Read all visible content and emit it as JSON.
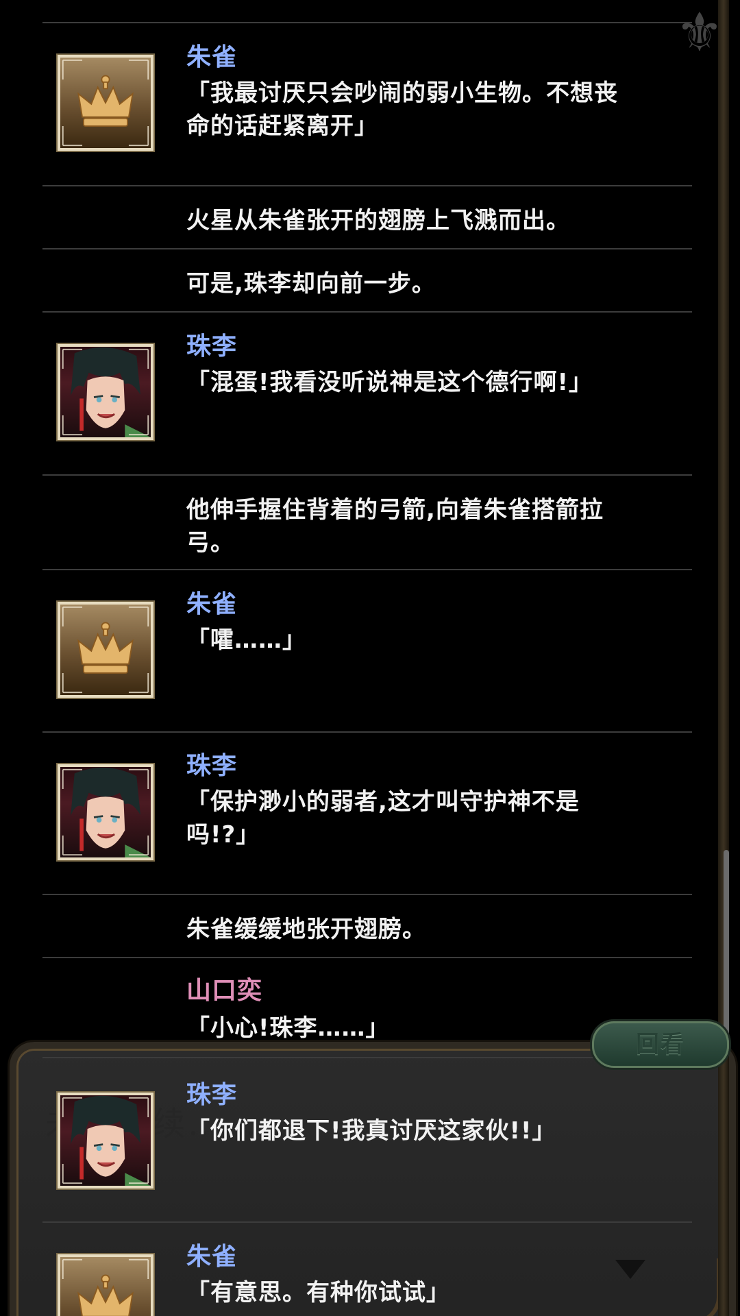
{
  "log": {
    "entries": [
      {
        "speaker": "朱雀",
        "text": "「我最讨厌只会吵闹的弱小生物。不想丧命的话赶紧离开」",
        "avatar": "crown-icon"
      },
      {
        "speaker": "",
        "text": "火星从朱雀张开的翅膀上飞溅而出。"
      },
      {
        "speaker": "",
        "text": "可是,珠李却向前一步。"
      },
      {
        "speaker": "珠李",
        "text": "「混蛋!我看没听说神是这个德行啊!」",
        "avatar": "zhuli-portrait"
      },
      {
        "speaker": "",
        "text": "他伸手握住背着的弓箭,向着朱雀搭箭拉弓。"
      },
      {
        "speaker": "朱雀",
        "text": "「嚯……」",
        "avatar": "crown-icon"
      },
      {
        "speaker": "珠李",
        "text": "「保护渺小的弱者,这才叫守护神不是吗!?」",
        "avatar": "zhuli-portrait"
      },
      {
        "speaker": "",
        "text": "朱雀缓缓地张开翅膀。"
      },
      {
        "speaker": "山口奕",
        "text": "「小心!珠李……」"
      },
      {
        "speaker": "珠李",
        "text": "「你们都退下!我真讨厌这家伙!!」",
        "avatar": "zhuli-portrait"
      },
      {
        "speaker": "朱雀",
        "text": "「有意思。有种你试试」",
        "avatar": "crown-icon"
      }
    ]
  },
  "controls": {
    "review_label": "回看"
  },
  "background": {
    "faded_text": "未完待续……"
  },
  "colors": {
    "speaker_blue": "#8fb0ff",
    "speaker_pink": "#e08fb8",
    "text": "#f2f2f2",
    "divider": "#3c3c3c"
  }
}
